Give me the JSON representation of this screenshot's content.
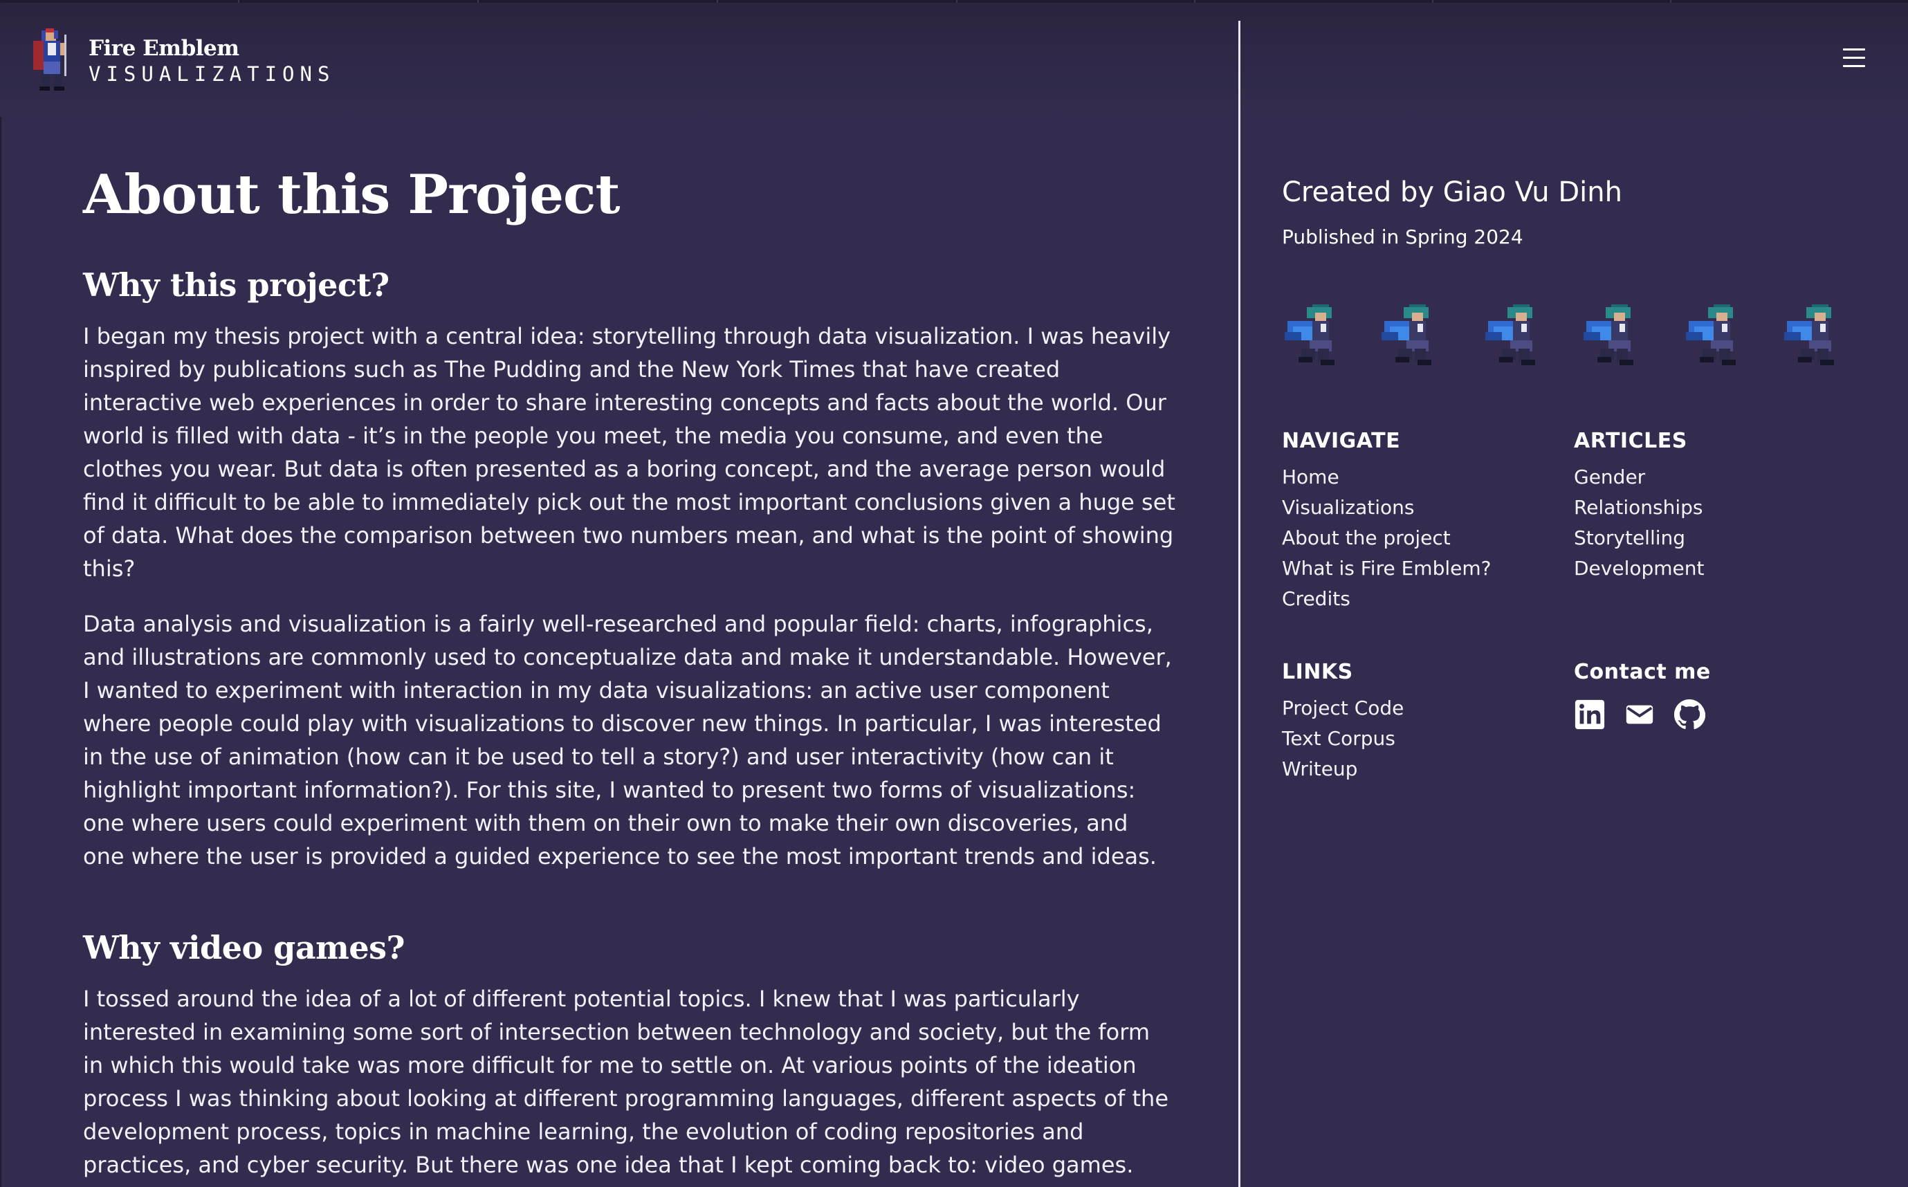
{
  "colors": {
    "background": "#332c4e",
    "header": "#2a2440",
    "text": "#ffffff",
    "divider": "#e9e6f2"
  },
  "header": {
    "logo_title": "Fire Emblem",
    "logo_subtitle": "VISUALIZATIONS",
    "menu_icon": "hamburger-menu-icon"
  },
  "main": {
    "title": "About this Project",
    "sections": [
      {
        "heading": "Why this project?",
        "paragraphs": [
          "I began my thesis project with a central idea: storytelling through data visualization. I was heavily inspired by publications such as The Pudding and the New York Times that have created interactive web experiences in order to share interesting concepts and facts about the world. Our world is filled with data - it’s in the people you meet, the media you consume, and even the clothes you wear. But data is often presented as a boring concept, and the average person would find it difficult to be able to immediately pick out the most important conclusions given a huge set of data. What does the comparison between two numbers mean, and what is the point of showing this?",
          "Data analysis and visualization is a fairly well-researched and popular field: charts, infographics, and illustrations are commonly used to conceptualize data and make it understandable. However, I wanted to experiment with interaction in my data visualizations: an active user component where people could play with visualizations to discover new things. In particular, I was interested in the use of animation (how can it be used to tell a story?) and user interactivity (how can it highlight important information?). For this site, I wanted to present two forms of visualizations: one where users could experiment with them on their own to make their own discoveries, and one where the user is provided a guided experience to see the most important trends and ideas."
        ]
      },
      {
        "heading": "Why video games?",
        "paragraphs": [
          "I tossed around the idea of a lot of different potential topics. I knew that I was particularly interested in examining some sort of intersection between technology and society, but the form in which this would take was more difficult for me to settle on. At various points of the ideation process I was thinking about looking at different programming languages, different aspects of the development process, topics in machine learning, the evolution of coding repositories and practices, and cyber security. But there was one idea that I kept coming back to: video games."
        ]
      }
    ]
  },
  "sidebar": {
    "created_by": "Created by Giao Vu Dinh",
    "published": "Published in Spring 2024",
    "sprite_icon": "character-sprite-icon",
    "navigate": {
      "heading": "NAVIGATE",
      "items": [
        "Home",
        "Visualizations",
        "About the project",
        "What is Fire Emblem?",
        "Credits"
      ]
    },
    "articles": {
      "heading": "ARTICLES",
      "items": [
        "Gender",
        "Relationships",
        "Storytelling",
        "Development"
      ]
    },
    "links": {
      "heading": "LINKS",
      "items": [
        "Project Code",
        "Text Corpus",
        "Writeup"
      ]
    },
    "contact": {
      "heading": "Contact me",
      "icons": [
        "linkedin-icon",
        "mail-icon",
        "github-icon"
      ]
    }
  }
}
